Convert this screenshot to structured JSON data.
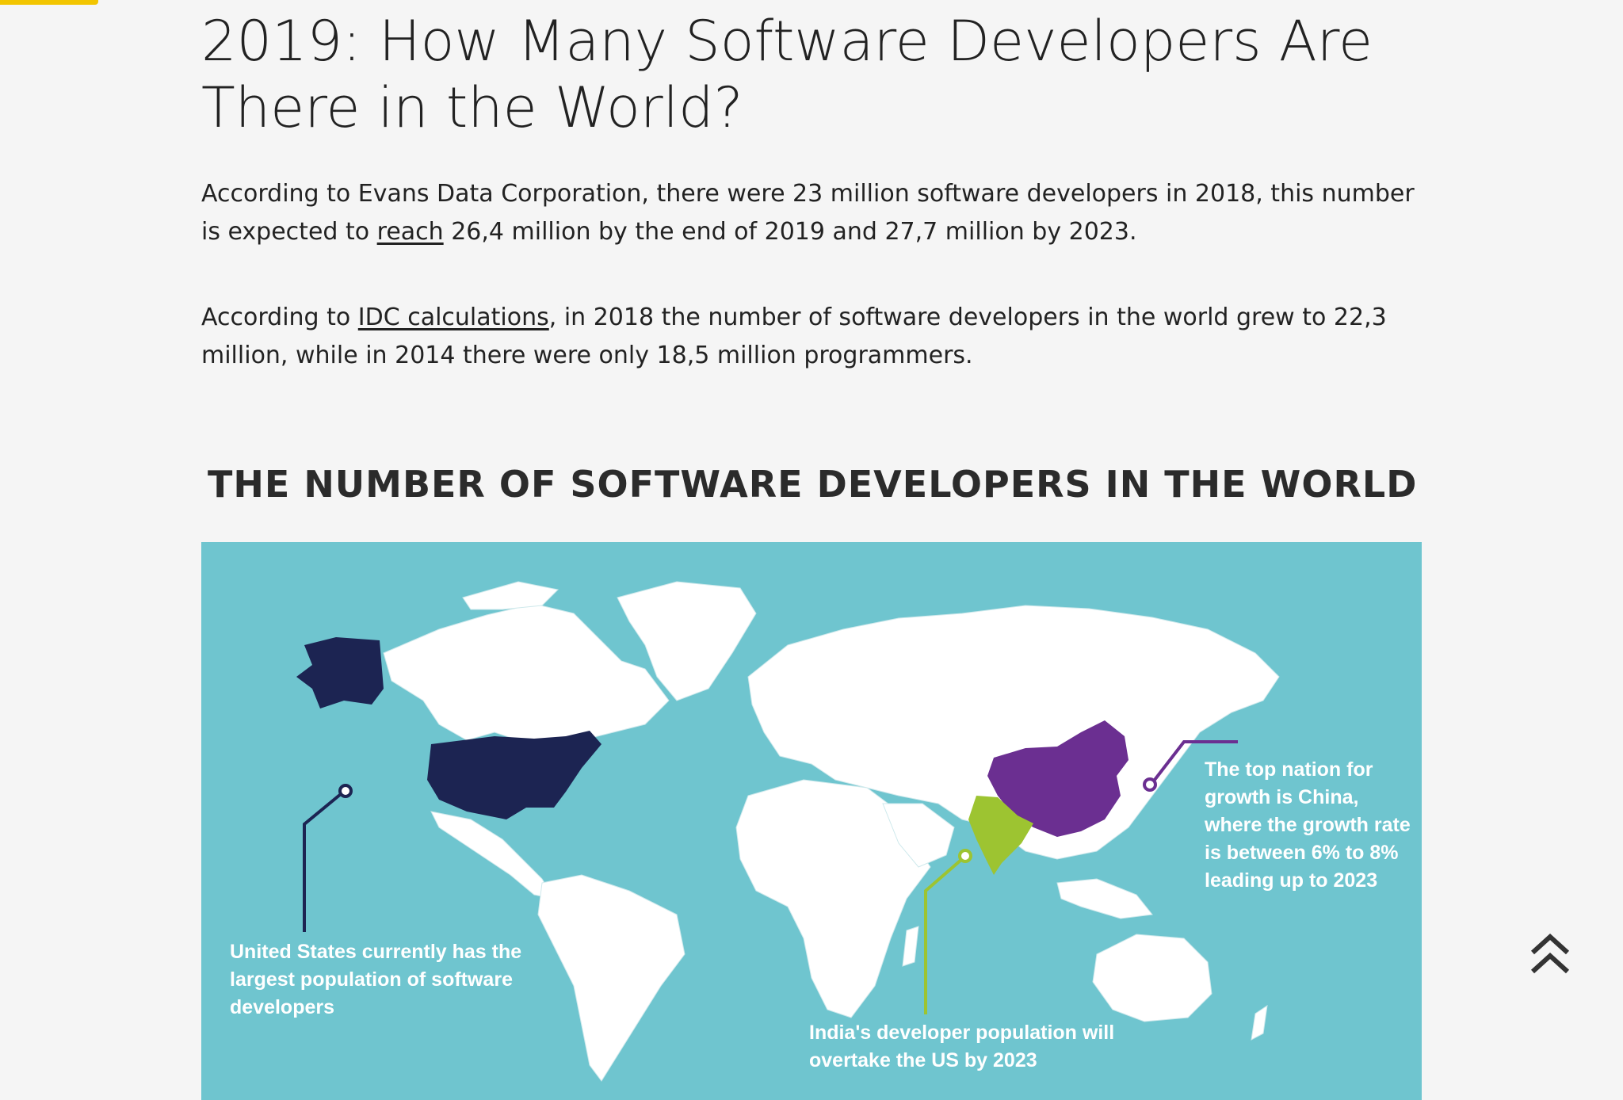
{
  "article": {
    "title": "2019: How Many Software Developers Are There in the World?",
    "p1_before": "According to Evans Data Corporation, there were 23 million software developers in 2018, this number is expected to ",
    "p1_link": "reach",
    "p1_after": " 26,4 million by the end of 2019 and 27,7 million by 2023.",
    "p2_before": "According to ",
    "p2_link": "IDC calculations",
    "p2_after": ", in 2018 the number of software developers in the world grew to 22,3 million, while in 2014 there were only 18,5 million programmers."
  },
  "infographic": {
    "title": "THE NUMBER OF SOFTWARE DEVELOPERS IN THE WORLD",
    "callouts": {
      "us": "United States currently has the largest population of software developers",
      "china": "The top nation for growth is China, where the growth rate is between 6% to 8% leading up to 2023",
      "india": "India's developer population will overtake the US by 2023"
    }
  },
  "colors": {
    "accent": "#f2c500",
    "ocean": "#6fc5cf",
    "land": "#ffffff",
    "us": "#1c2452",
    "china": "#6b2f91",
    "india": "#9dc431"
  },
  "icons": {
    "scroll_top": "double-chevron-up-icon"
  }
}
